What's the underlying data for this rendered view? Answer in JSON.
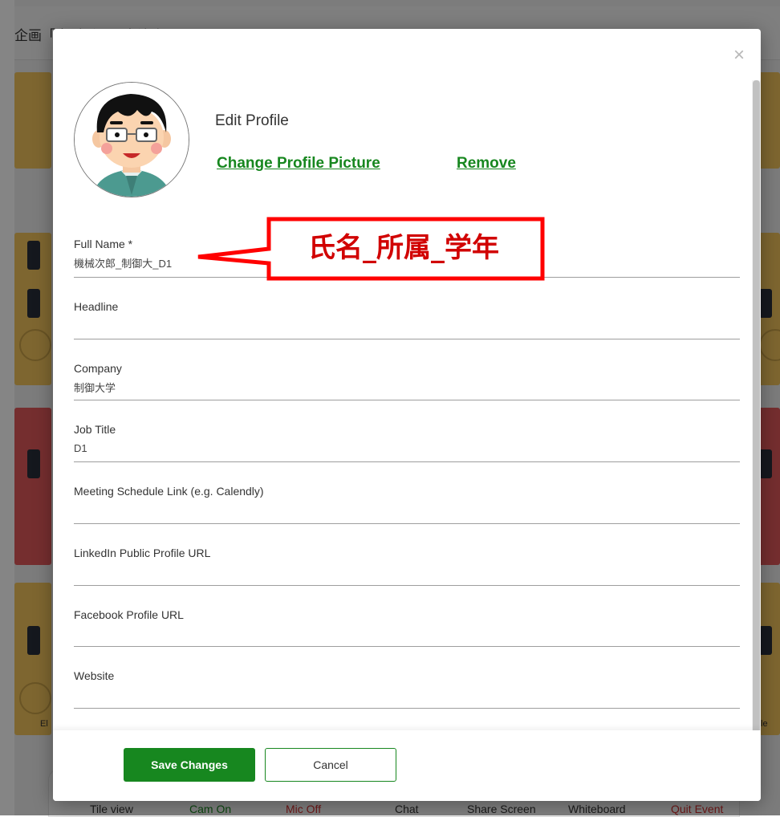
{
  "background": {
    "event_title": "企画「人脈づくり交流会」",
    "toolbar": {
      "tile_view": "Tile view",
      "cam_on": "Cam On",
      "mic_off": "Mic Off",
      "chat": "Chat",
      "share_screen": "Share Screen",
      "whiteboard": "Whiteboard",
      "quit_event": "Quit Event"
    },
    "left_table_label": "El",
    "right_table_label": "le"
  },
  "modal": {
    "close_icon": "close-icon",
    "title": "Edit Profile",
    "change_picture_label": "Change Profile Picture",
    "remove_label": "Remove",
    "fields": [
      {
        "label": "Full Name *",
        "value": "機械次郎_制御大_D1"
      },
      {
        "label": "Headline",
        "value": ""
      },
      {
        "label": "Company",
        "value": "制御大学"
      },
      {
        "label": "Job Title",
        "value": "D1"
      },
      {
        "label": "Meeting Schedule Link (e.g. Calendly)",
        "value": ""
      },
      {
        "label": "LinkedIn Public Profile URL",
        "value": ""
      },
      {
        "label": "Facebook Profile URL",
        "value": ""
      },
      {
        "label": "Website",
        "value": ""
      }
    ],
    "save_label": "Save Changes",
    "cancel_label": "Cancel"
  },
  "annotation": {
    "callout_text": "氏名_所属_学年",
    "color": "#ff0000"
  },
  "colors": {
    "accent": "#17871f",
    "quit": "#d32f2f",
    "mic_off": "#d32f2f"
  }
}
